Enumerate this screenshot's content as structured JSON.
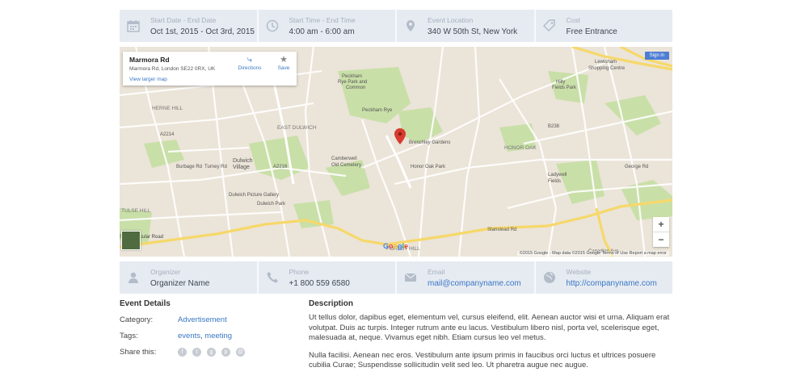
{
  "event_info": [
    {
      "label": "Start Date - End Date",
      "value": "Oct 1st, 2015 - Oct 3rd, 2015",
      "icon": "calendar-icon"
    },
    {
      "label": "Start Time - End Time",
      "value": "4:00 am - 6:00 am",
      "icon": "clock-icon"
    },
    {
      "label": "Event Location",
      "value": "340 W 50th St, New York",
      "icon": "location-pin-icon"
    },
    {
      "label": "Cost",
      "value": "Free Entrance",
      "icon": "tag-icon"
    }
  ],
  "map": {
    "place_title": "Marmora Rd",
    "place_address": "Marmora Rd, London SE22 0RX, UK",
    "view_larger": "View larger map",
    "directions": "Directions",
    "save": "Save",
    "sign_in": "Sign in",
    "zoom_in": "+",
    "zoom_out": "−",
    "google_logo": "Google",
    "footer": "©2015 Google - Map data ©2015 Google   Terms of Use   Report a map error",
    "labels": [
      "Peckham Rye Park and Common",
      "EAST DULWICH",
      "HERNE HILL",
      "Dulwich Village",
      "Dulwich Picture Gallery",
      "Dulwich Park",
      "Camberwell Old Cemetery",
      "HONOR OAK",
      "Lewisham Shopping Centre",
      "Hilly Fields Park",
      "Ladywell Fields",
      "FOREST HILL",
      "South Circular Road",
      "Stanstead Rd",
      "TULSE HILL",
      "Brenchley Gardens",
      "Honor Oak Park",
      "Forest Hill Rd",
      "Peckham Rye",
      "Lordship Ln",
      "Turney Rd",
      "Burbage Rd",
      "Croxted Rd",
      "A2214",
      "A2216",
      "B238",
      "B218",
      "A205"
    ]
  },
  "organizer_info": [
    {
      "label": "Organizer",
      "value": "Organizer Name",
      "icon": "user-icon",
      "link": false
    },
    {
      "label": "Phone",
      "value": "+1 800 559 6580",
      "icon": "phone-icon",
      "link": false
    },
    {
      "label": "Email",
      "value": "mail@companyname.com",
      "icon": "email-icon",
      "link": true
    },
    {
      "label": "Website",
      "value": "http://companyname.com",
      "icon": "globe-icon",
      "link": true
    }
  ],
  "details": {
    "heading": "Event Details",
    "category_label": "Category:",
    "category_value": "Advertisement",
    "tags_label": "Tags:",
    "tag_1": "events",
    "tag_sep": ",",
    "tag_2": "meeting",
    "share_label": "Share this:",
    "share_icons": [
      "facebook-icon",
      "twitter-icon",
      "google-plus-icon",
      "pinterest-icon",
      "email-icon"
    ]
  },
  "description": {
    "heading": "Description",
    "paragraph_1": "Ut tellus dolor, dapibus eget, elementum vel, cursus eleifend, elit. Aenean auctor wisi et urna. Aliquam erat volutpat. Duis ac turpis. Integer rutrum ante eu lacus. Vestibulum libero nisl, porta vel, scelerisque eget, malesuada at, neque. Vivamus eget nibh. Etiam cursus leo vel metus.",
    "paragraph_2": "Nulla facilisi. Aenean nec eros. Vestibulum ante ipsum primis in faucibus orci luctus et ultrices posuere cubilia Curae; Suspendisse sollicitudin velit sed leo. Ut pharetra augue nec augue."
  },
  "colors": {
    "accent": "#3a77c4",
    "bar_bg": "#e6ebf2",
    "icon": "#b3bcc8"
  }
}
